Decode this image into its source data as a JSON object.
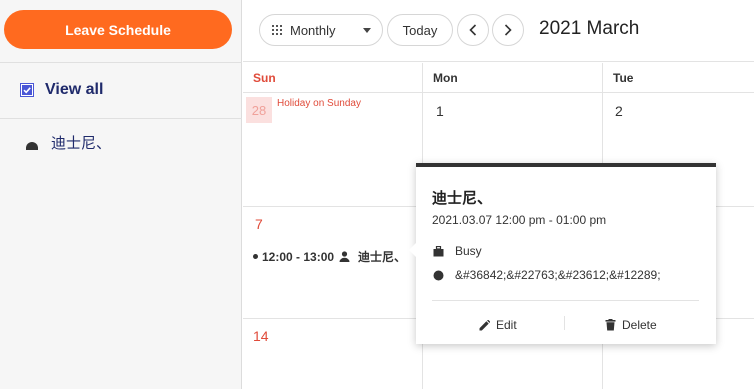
{
  "sidebar": {
    "leave_button": "Leave Schedule",
    "view_all_label": "View all",
    "view_all_checked": true,
    "calendars": [
      {
        "label": "迪士尼、"
      }
    ]
  },
  "header": {
    "view_mode": "Monthly",
    "today_label": "Today",
    "range_title": "2021 March"
  },
  "month": {
    "weekdays": [
      "Sun",
      "Mon",
      "Tue"
    ],
    "rows": [
      {
        "days": [
          "28",
          "1",
          "2"
        ],
        "holiday_label": "Holiday on Sunday"
      },
      {
        "days": [
          "7"
        ]
      },
      {
        "days": [
          "14"
        ]
      }
    ],
    "event": {
      "time": "12:00 - 13:00",
      "title": "迪士尼、"
    }
  },
  "popup": {
    "title": "迪士尼、",
    "datetime": "2021.03.07 12:00 pm - 01:00 pm",
    "state": "Busy",
    "calendar_name": "&#36842;&#22763;&#23612;&#12289;",
    "edit_label": "Edit",
    "delete_label": "Delete"
  },
  "colors": {
    "accent": "#ff6a1f",
    "sunday": "#e04b3a",
    "checkbox": "#4a56d6",
    "label_navy": "#1f2a6b"
  }
}
